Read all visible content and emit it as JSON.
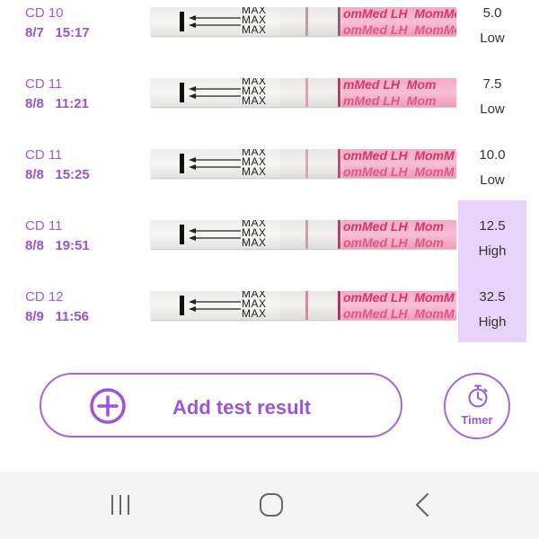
{
  "results": [
    {
      "cycle_day": "CD 10",
      "date": "8/7",
      "time": "15:17",
      "strip_brand": "omMed LH  MomMed",
      "value": "5.0",
      "level": "Low",
      "highlight": false,
      "line_color": "#b8a0a8",
      "test_line_color": "#9a5a70"
    },
    {
      "cycle_day": "CD 11",
      "date": "8/8",
      "time": "11:21",
      "strip_brand": "mMed LH  Mom",
      "value": "7.5",
      "level": "Low",
      "highlight": false,
      "line_color": "#d9a2b3",
      "test_line_color": "#c23a64"
    },
    {
      "cycle_day": "CD 11",
      "date": "8/8",
      "time": "15:25",
      "strip_brand": "omMed LH  MomM",
      "value": "10.0",
      "level": "Low",
      "highlight": false,
      "line_color": "#d5a9b6",
      "test_line_color": "#c64a6f"
    },
    {
      "cycle_day": "CD 11",
      "date": "8/8",
      "time": "19:51",
      "strip_brand": "omMed LH  Mom",
      "value": "12.5",
      "level": "High",
      "highlight": true,
      "line_color": "#cc9fb0",
      "test_line_color": "#c03a64"
    },
    {
      "cycle_day": "CD 12",
      "date": "8/9",
      "time": "11:56",
      "strip_brand": "omMed LH  MomM",
      "value": "32.5",
      "level": "High",
      "highlight": true,
      "line_color": "#d58aa6",
      "test_line_color": "#bd2c5a"
    }
  ],
  "strip": {
    "max_text": "MAX"
  },
  "actions": {
    "add_result_label": "Add test result",
    "timer_label": "Timer"
  },
  "colors": {
    "accent": "#9b55d6",
    "high_highlight": "#e8d4fb",
    "nav_bar_bg": "#f4f4f4"
  },
  "icons": {
    "add": "plus-circle-icon",
    "timer": "stopwatch-icon",
    "nav_recent": "recent-apps-icon",
    "nav_home": "home-icon",
    "nav_back": "back-icon"
  }
}
